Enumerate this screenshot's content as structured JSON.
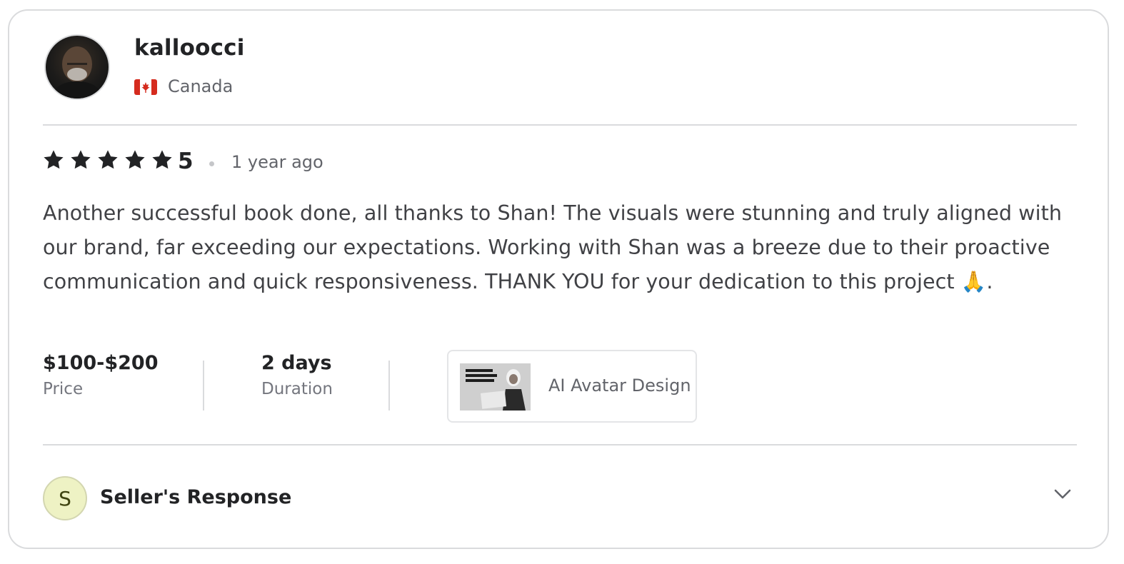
{
  "review": {
    "username": "kalloocci",
    "country": "Canada",
    "rating": "5",
    "stars": 5,
    "time_ago": "1 year ago",
    "text": "Another successful book done, all thanks to Shan! The visuals were stunning and truly aligned with our brand, far exceeding our expectations. Working with Shan was a breeze due to their proactive communication and quick responsiveness. THANK YOU for your dedication to this project 🙏."
  },
  "stats": {
    "price_value": "$100-$200",
    "price_label": "Price",
    "duration_value": "2 days",
    "duration_label": "Duration"
  },
  "gig": {
    "title": "AI Avatar Design"
  },
  "seller_response": {
    "initial": "S",
    "title": "Seller's Response"
  },
  "icons": {
    "star": "star-icon",
    "flag": "canada-flag-icon",
    "chevron": "chevron-down-icon"
  },
  "colors": {
    "star": "#222325",
    "flag_red": "#d52b1e",
    "seller_badge_bg": "#eef2c4",
    "divider": "#dadbdd"
  }
}
